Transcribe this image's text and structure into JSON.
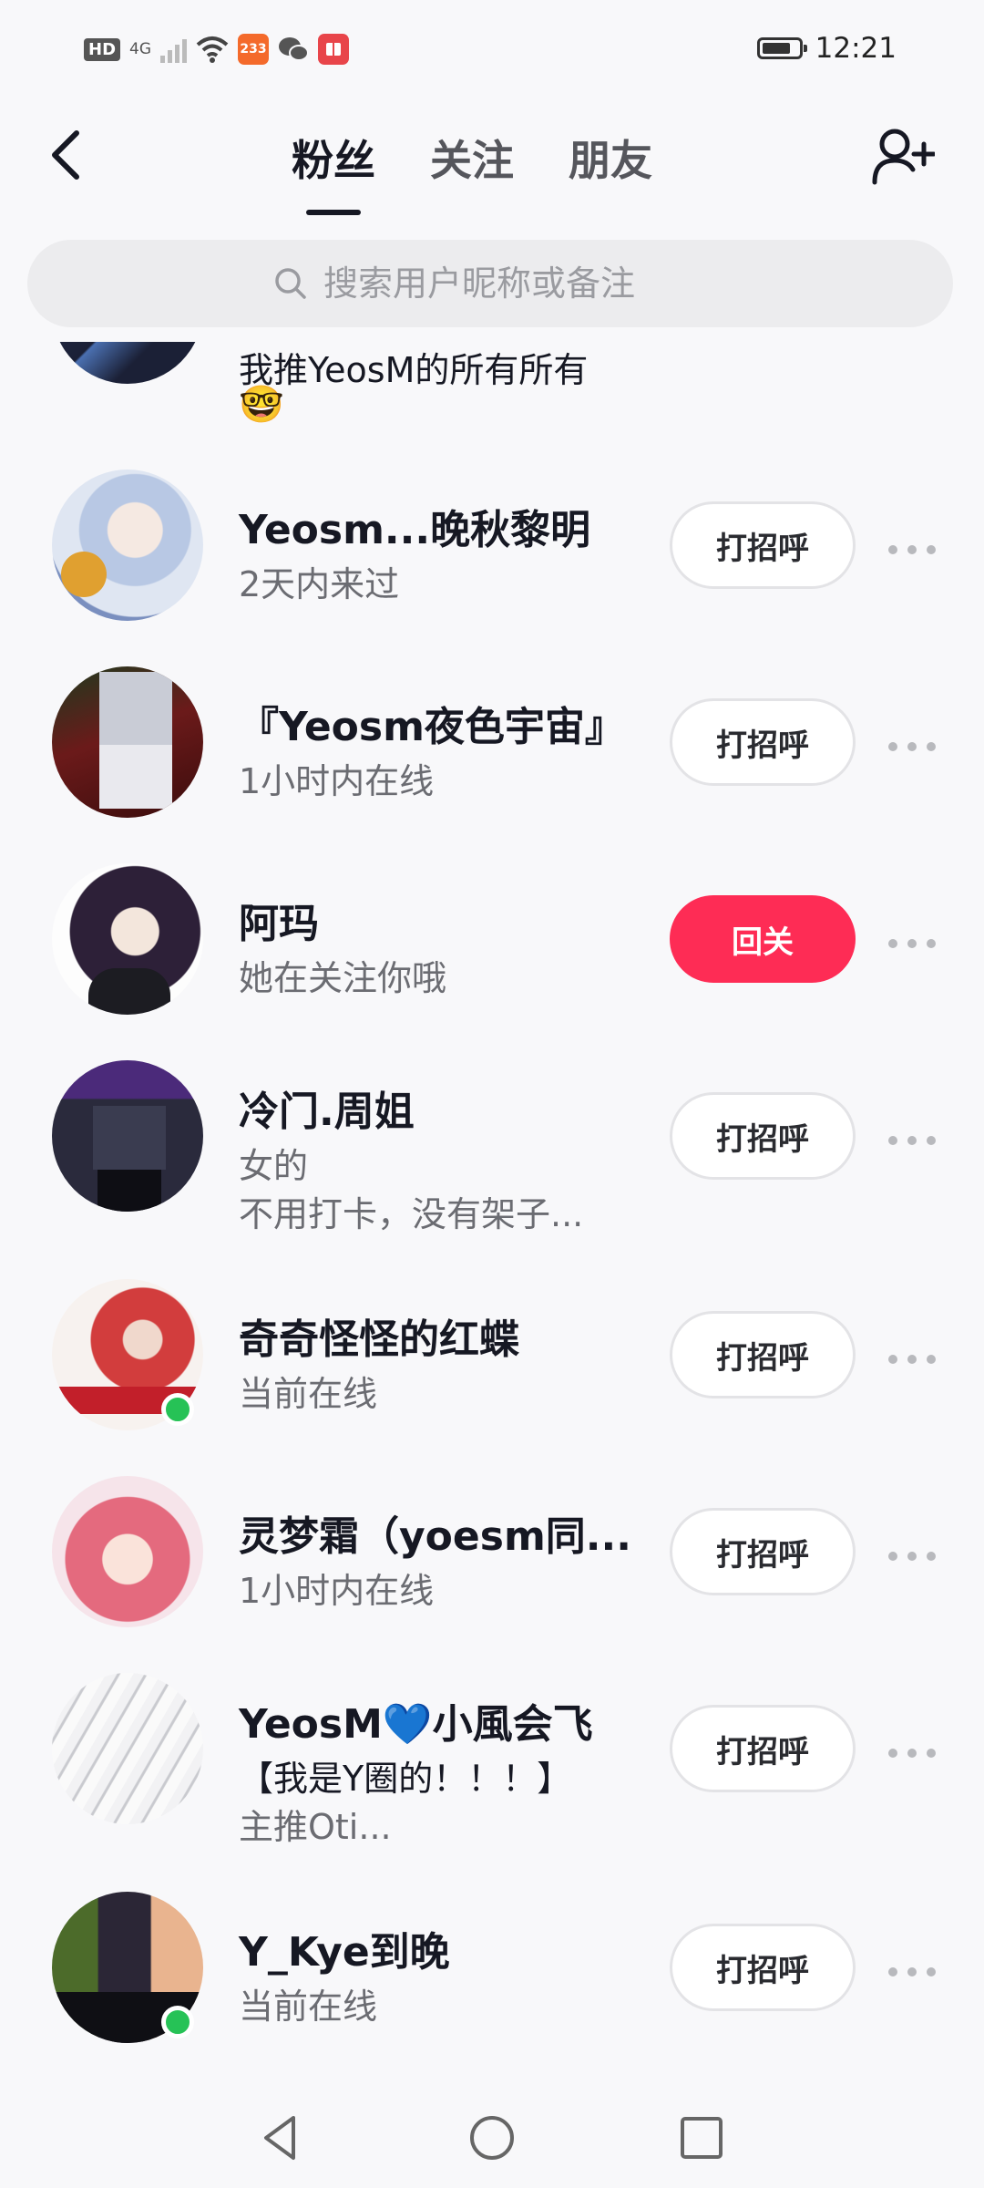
{
  "status_bar": {
    "hd": "HD",
    "network": "4G",
    "badge_number": "233",
    "time": "12:21"
  },
  "header": {
    "tabs": [
      {
        "label": "粉丝",
        "active": true
      },
      {
        "label": "关注",
        "active": false
      },
      {
        "label": "朋友",
        "active": false
      }
    ]
  },
  "search": {
    "placeholder": "搜索用户昵称或备注"
  },
  "partial_item": {
    "subtitle": "我推YeosM的所有所有",
    "emoji": "🤓"
  },
  "followers": [
    {
      "name": "Yeosm...晚秋黎明",
      "subtitle": "2天内来过",
      "button": "打招呼",
      "primary": false,
      "online": false
    },
    {
      "name": "『Yeosm夜色宇宙』",
      "subtitle": "1小时内在线",
      "button": "打招呼",
      "primary": false,
      "online": false
    },
    {
      "name": "阿玛",
      "subtitle": "她在关注你哦",
      "button": "回关",
      "primary": true,
      "online": false
    },
    {
      "name": "冷门.周姐",
      "subtitle": "女的",
      "subtitle2": "不用打卡，没有架子...",
      "button": "打招呼",
      "primary": false,
      "online": false
    },
    {
      "name": "奇奇怪怪的红蝶",
      "subtitle": "当前在线",
      "button": "打招呼",
      "primary": false,
      "online": true
    },
    {
      "name": "灵梦霜（yoesm同...",
      "subtitle": "1小时内在线",
      "button": "打招呼",
      "primary": false,
      "online": false
    },
    {
      "name": "YeosM💙小風会飞",
      "subtitle": "【我是Y圈的！！！】",
      "subtitle2": "主推Oti...",
      "button": "打招呼",
      "primary": false,
      "online": false
    },
    {
      "name": "Y_Kye到晚",
      "subtitle": "当前在线",
      "button": "打招呼",
      "primary": false,
      "online": true
    }
  ],
  "colors": {
    "accent": "#fe2c55",
    "online": "#26c256"
  }
}
